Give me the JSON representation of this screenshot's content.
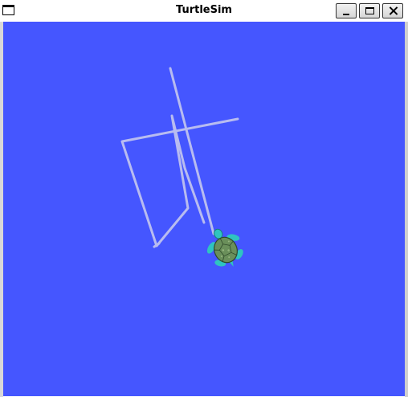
{
  "window": {
    "title": "TurtleSim"
  },
  "titlebar_buttons": [
    {
      "name": "minimize",
      "icon": "minimize-icon"
    },
    {
      "name": "maximize",
      "icon": "maximize-icon"
    },
    {
      "name": "close",
      "icon": "close-icon"
    }
  ],
  "colors": {
    "background": "#4556ff",
    "pen": "#b8bcf0",
    "turtle_shell": "#6a8f5a",
    "turtle_limbs": "#2fc4c0"
  }
}
